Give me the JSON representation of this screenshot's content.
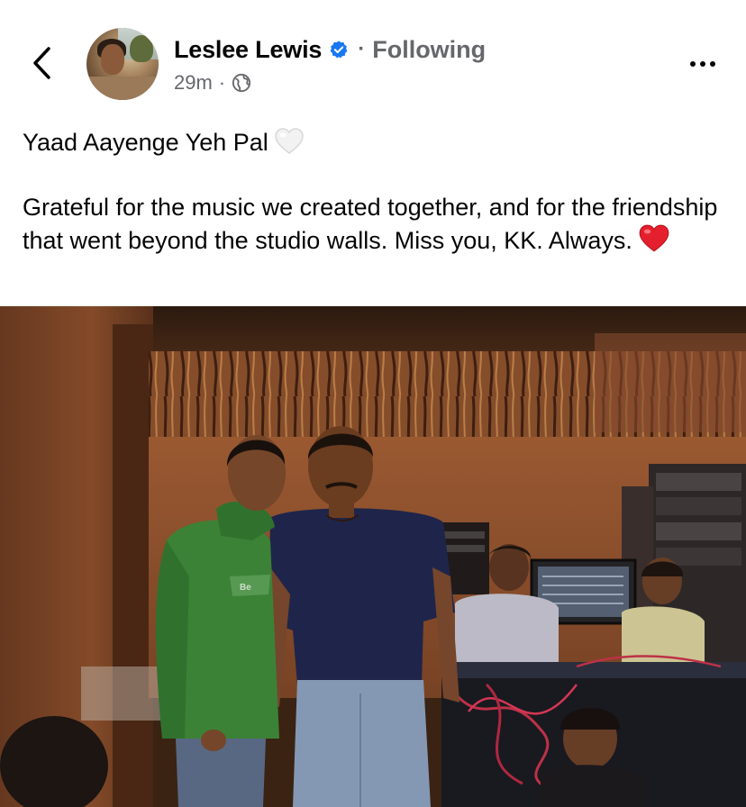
{
  "header": {
    "author_name": "Leslee Lewis",
    "separator": "·",
    "follow_status": "Following",
    "timestamp": "29m",
    "meta_separator": "·",
    "audience_icon": "globe-icon",
    "verified_icon": "verified-badge-icon",
    "verified_color": "#1877f2"
  },
  "post": {
    "line1": "Yaad Aayenge Yeh Pal",
    "line1_emoji": "white-heart-icon",
    "line2": "Grateful for the music we created together, and for the friendship that went beyond the studio walls. Miss you, KK. Always.",
    "line2_emoji": "red-heart-icon"
  },
  "photo": {
    "jersey_text": "Be"
  },
  "colors": {
    "text": "#050505",
    "secondary": "#65676b",
    "background": "#ffffff"
  }
}
